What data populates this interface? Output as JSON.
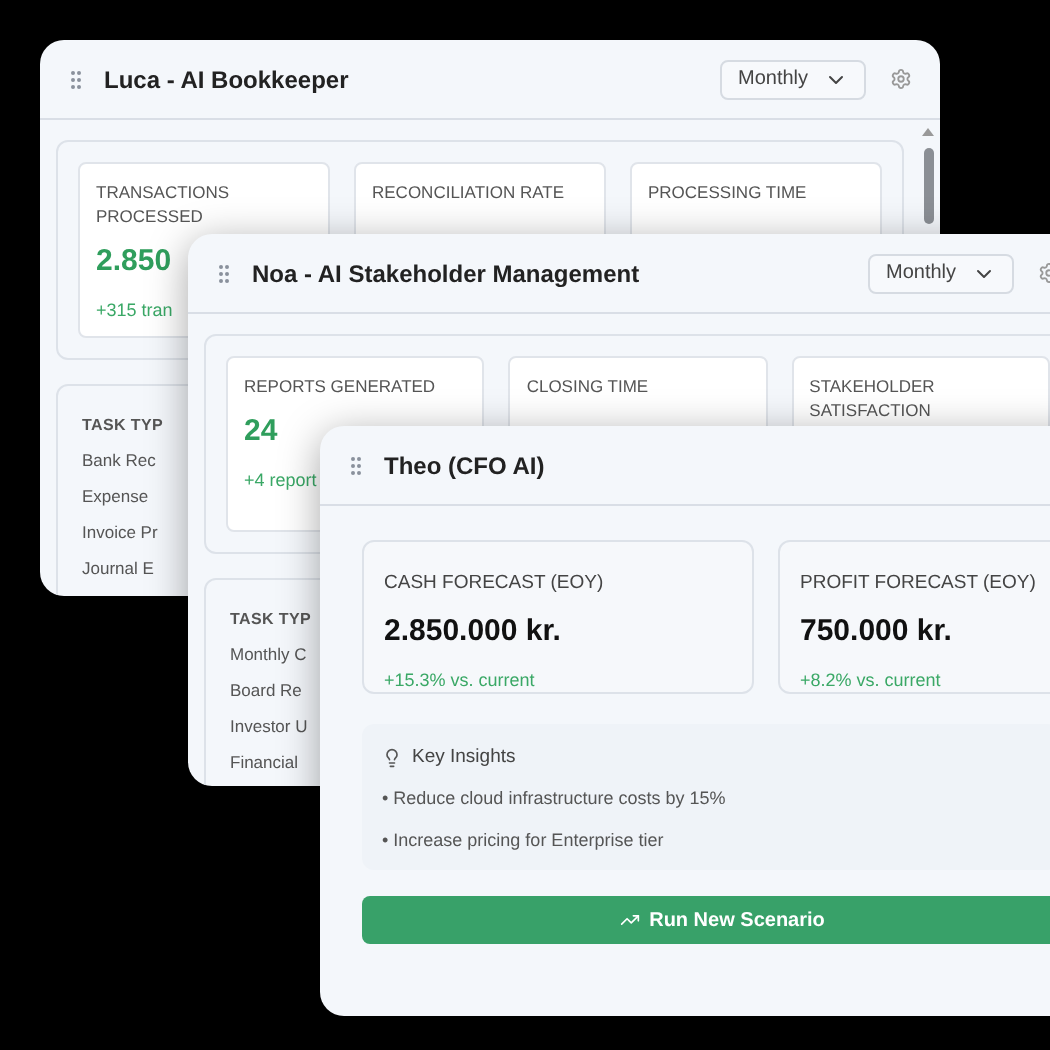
{
  "windows": [
    {
      "title": "Luca - AI Bookkeeper",
      "period": "Monthly",
      "metrics": [
        {
          "label": "TRANSACTIONS PROCESSED",
          "value": "2.850",
          "change": "+315 tran"
        },
        {
          "label": "RECONCILIATION RATE"
        },
        {
          "label": "PROCESSING TIME"
        }
      ],
      "tasks": {
        "heading": "TASK TYP",
        "items": [
          "Bank Rec",
          "Expense",
          "Invoice Pr",
          "Journal E"
        ]
      }
    },
    {
      "title": "Noa - AI Stakeholder Management",
      "period": "Monthly",
      "metrics": [
        {
          "label": "REPORTS GENERATED",
          "value": "24",
          "change": "+4 report"
        },
        {
          "label": "CLOSING TIME"
        },
        {
          "label": "STAKEHOLDER SATISFACTION"
        }
      ],
      "tasks": {
        "heading": "TASK TYP",
        "items": [
          "Monthly C",
          "Board Re",
          "Investor U",
          "Financial"
        ]
      }
    }
  ],
  "theo": {
    "title": "Theo (CFO AI)",
    "forecasts": [
      {
        "label": "CASH FORECAST (EOY)",
        "value": "2.850.000 kr.",
        "change": "+15.3% vs. current"
      },
      {
        "label": "PROFIT FORECAST (EOY)",
        "value": "750.000 kr.",
        "change": "+8.2% vs. current"
      }
    ],
    "insights": {
      "title": "Key Insights",
      "items": [
        "• Reduce cloud infrastructure costs by 15%",
        "• Increase pricing for Enterprise tier"
      ]
    },
    "action": "Run New Scenario"
  }
}
